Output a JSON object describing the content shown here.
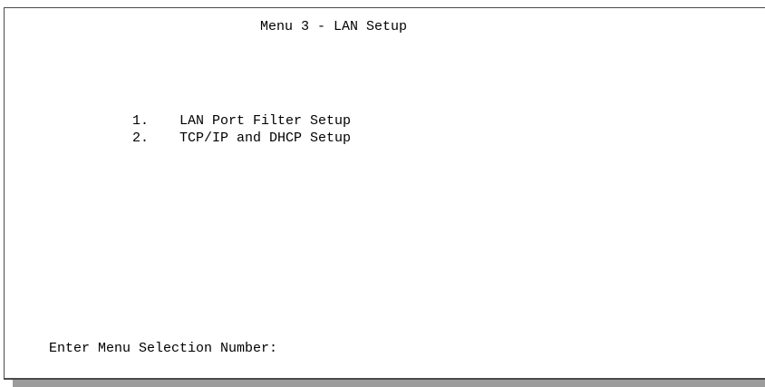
{
  "screen": {
    "title": "Menu 3 - LAN Setup"
  },
  "menu": {
    "items": [
      {
        "number": "1.",
        "label": "LAN Port Filter Setup"
      },
      {
        "number": "2.",
        "label": "TCP/IP and DHCP Setup"
      }
    ]
  },
  "prompt": {
    "label": "Enter Menu Selection Number:",
    "value": ""
  },
  "colors": {
    "border": "#4a4a4a",
    "shadow": "#9c9c9c",
    "text": "#000000",
    "background": "#ffffff"
  }
}
